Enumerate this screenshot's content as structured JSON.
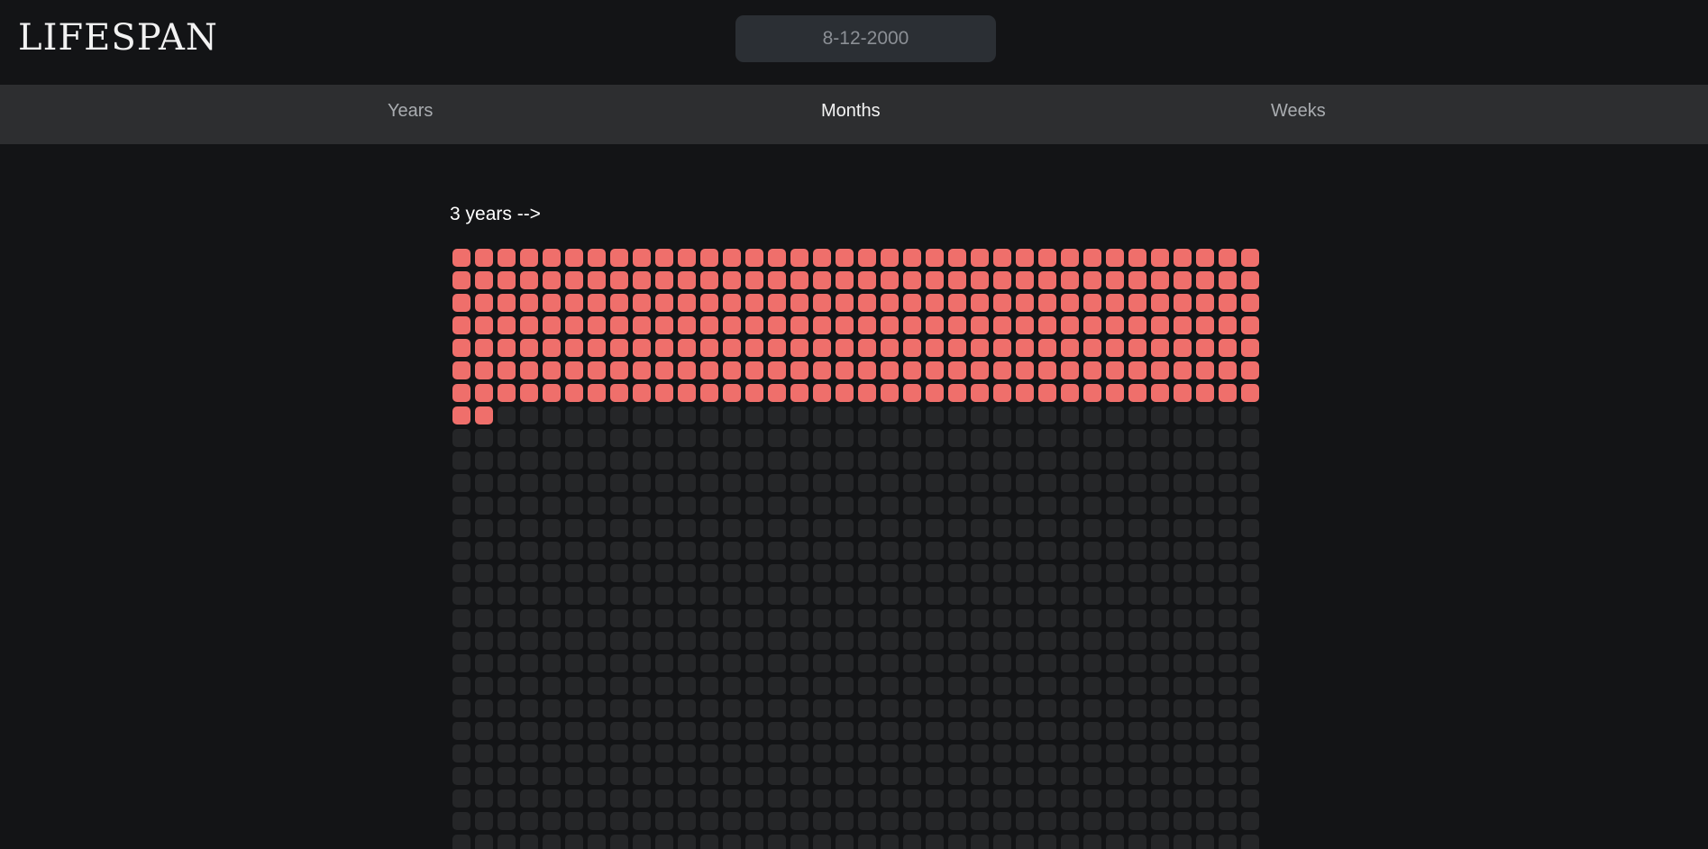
{
  "app": {
    "logo_text": "LIFESPAN"
  },
  "birthdate": {
    "placeholder": "8-12-2000"
  },
  "tabs": [
    {
      "label": "Years"
    },
    {
      "label": "Months",
      "active": true
    },
    {
      "label": "Weeks"
    }
  ],
  "grid": {
    "caption": "3 years -->",
    "columns": 36,
    "months_lived": 254,
    "lived_color": "#ef6f6b",
    "remaining_color": "#252628"
  }
}
